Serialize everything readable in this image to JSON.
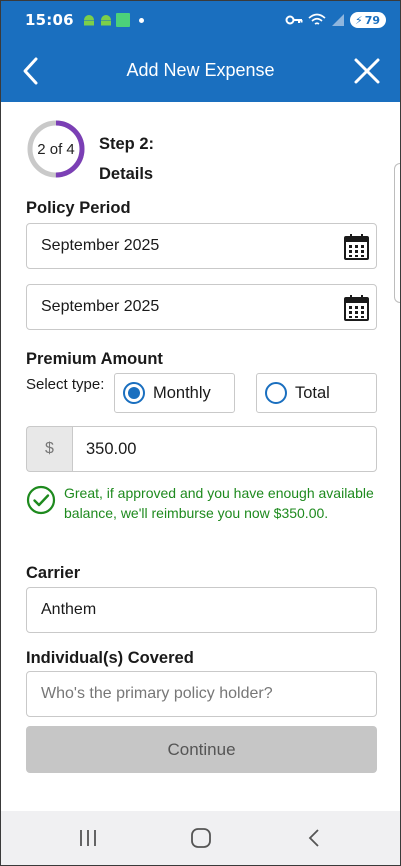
{
  "status_bar": {
    "time": "15:06",
    "battery": "79"
  },
  "header": {
    "title": "Add New Expense"
  },
  "step": {
    "progress_text": "2 of 4",
    "current": 2,
    "total": 4,
    "label_line1": "Step 2:",
    "label_line2": "Details",
    "ring_color": "#7b3fb5",
    "ring_track_color": "#c9c9c9"
  },
  "policy_period": {
    "label": "Policy Period",
    "start_value": "September 2025",
    "end_value": "September 2025"
  },
  "premium": {
    "label": "Premium Amount",
    "select_type_label": "Select type:",
    "options": [
      {
        "label": "Monthly",
        "selected": true
      },
      {
        "label": "Total",
        "selected": false
      }
    ],
    "currency_symbol": "$",
    "amount": "350.00",
    "success_message": "Great, if approved and you have enough available balance, we'll reimburse you now $350.00."
  },
  "carrier": {
    "label": "Carrier",
    "value": "Anthem"
  },
  "covered": {
    "label": "Individual(s) Covered",
    "placeholder": "Who's the primary policy holder?"
  },
  "continue_label": "Continue",
  "colors": {
    "brand_blue": "#1a6fbf",
    "success_green": "#1e8a1e",
    "disabled_gray": "#c6c6c6"
  }
}
